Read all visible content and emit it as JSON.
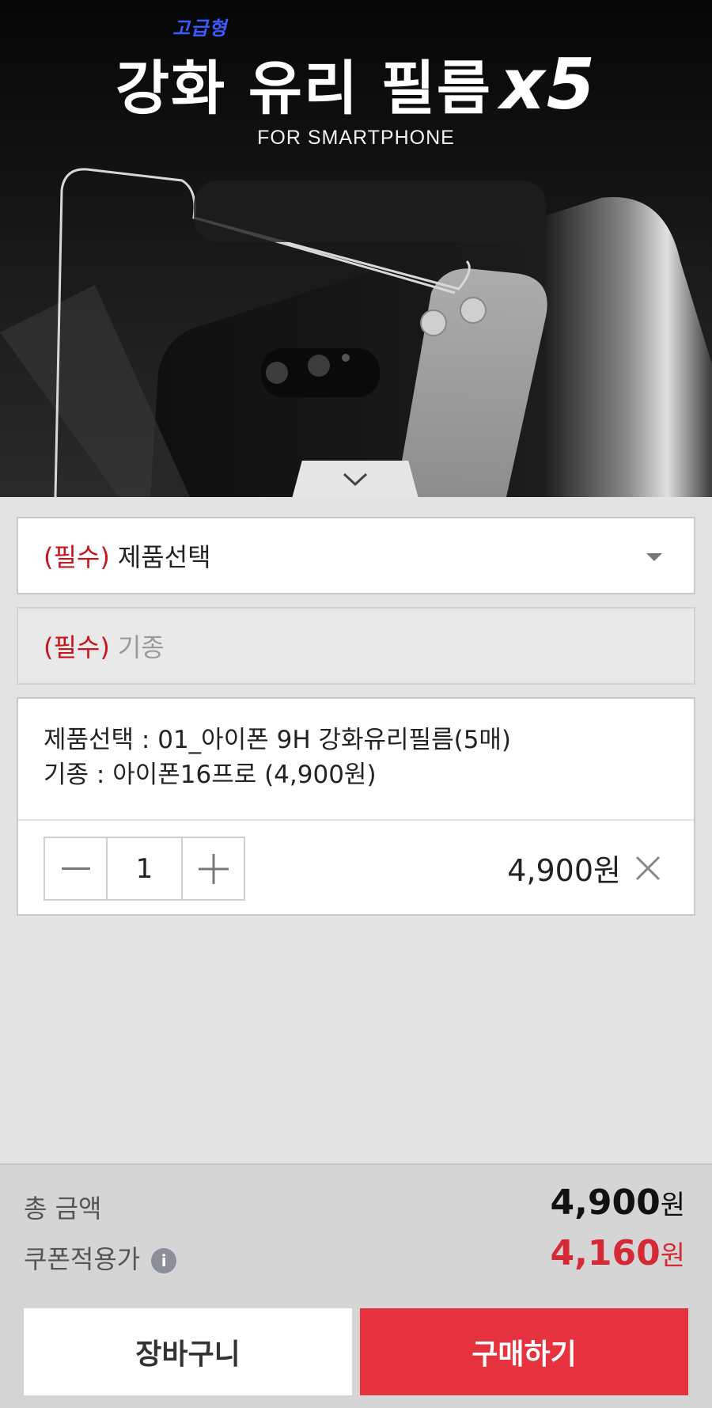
{
  "hero": {
    "tag": "고급형",
    "title": "강화 유리 필름",
    "title_multiplier": "x5",
    "subtitle": "FOR SMARTPHONE"
  },
  "options": {
    "product_select": {
      "required_label": "(필수)",
      "placeholder": "제품선택"
    },
    "model_select": {
      "required_label": "(필수)",
      "placeholder": "기종"
    }
  },
  "selected_item": {
    "product_line": "제품선택 : 01_아이폰 9H 강화유리필름(5매)",
    "model_line": "기종 : 아이폰16프로 (4,900원)",
    "quantity": "1",
    "price": "4,900원"
  },
  "summary": {
    "total_label": "총 금액",
    "total_value": "4,900",
    "total_unit": "원",
    "coupon_label": "쿠폰적용가",
    "coupon_value": "4,160",
    "coupon_unit": "원"
  },
  "actions": {
    "cart_label": "장바구니",
    "buy_label": "구매하기"
  },
  "colors": {
    "accent": "#e6323e",
    "required": "#c8161f",
    "coupon_price": "#d42a36"
  }
}
